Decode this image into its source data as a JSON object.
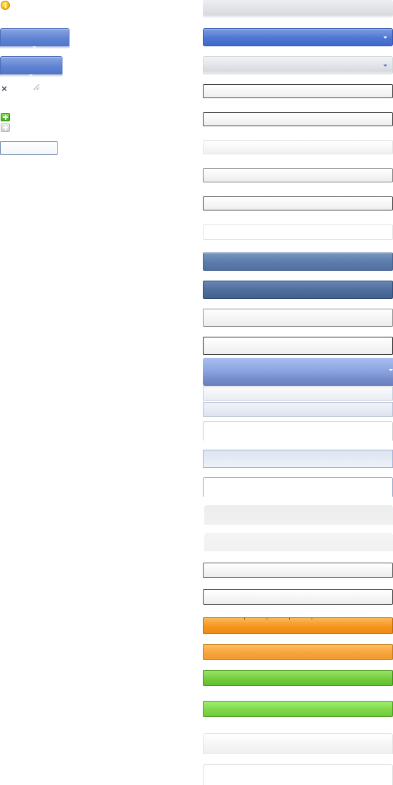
{
  "sprite_sheet": {
    "left_column": {
      "icons": [
        "info-icon",
        "close-icon",
        "resize-grip-icon",
        "add-icon-enabled",
        "add-icon-disabled"
      ],
      "callouts": 2
    },
    "right_column": {
      "dropdown_arrow_icon": "chevron-down-icon",
      "accent_colors": {
        "blue": "#4f76d2",
        "steel_blue": "#5b7caa",
        "orange": "#f5951f",
        "green": "#73cc3d",
        "gray": "#d8dadf"
      }
    }
  }
}
